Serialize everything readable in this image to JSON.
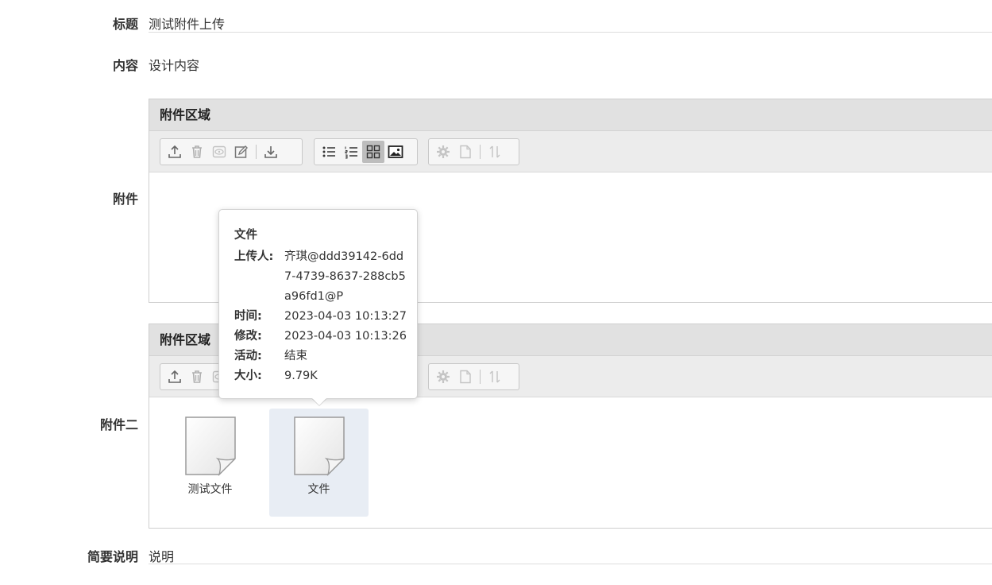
{
  "form": {
    "title_label": "标题",
    "title_value": "测试附件上传",
    "content_label": "内容",
    "content_value": "设计内容",
    "attachment_label": "附件",
    "attachment2_label": "附件二",
    "summary_label": "简要说明",
    "summary_value": "说明"
  },
  "panel1": {
    "header": "附件区域",
    "files": []
  },
  "panel2": {
    "header": "附件区域",
    "files": [
      {
        "name": "测试文件",
        "selected": false
      },
      {
        "name": "文件",
        "selected": true
      }
    ]
  },
  "toolbar": {
    "group1": [
      "upload-icon",
      "delete-icon",
      "preview-icon",
      "edit-icon",
      "download-icon"
    ],
    "group2": [
      "list-view-icon",
      "numbered-list-icon",
      "grid-view-icon",
      "image-view-icon"
    ],
    "group3": [
      "settings-icon",
      "document-icon",
      "sort-icon"
    ],
    "active_view": "grid-view-icon"
  },
  "tooltip": {
    "title": "文件",
    "uploader_label": "上传人:",
    "uploader_value": "齐琪@ddd39142-6dd7-4739-8637-288cb5a96fd1@P",
    "time_label": "时间:",
    "time_value": "2023-04-03 10:13:27",
    "modified_label": "修改:",
    "modified_value": "2023-04-03 10:13:26",
    "activity_label": "活动:",
    "activity_value": "结束",
    "size_label": "大小:",
    "size_value": "9.79K"
  },
  "colors": {
    "panel_header_bg": "#e1e1e1",
    "toolbar_bg": "#ececec",
    "selected_file_bg": "#e8edf4",
    "icon_color": "#555555",
    "icon_disabled": "#b5b5b5"
  }
}
